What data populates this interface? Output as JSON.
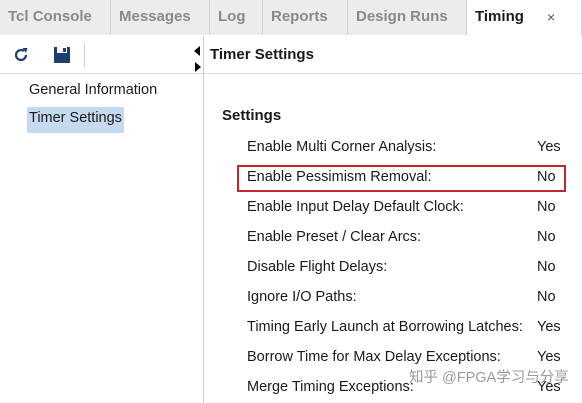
{
  "tabs": [
    {
      "label": "Tcl Console"
    },
    {
      "label": "Messages"
    },
    {
      "label": "Log"
    },
    {
      "label": "Reports"
    },
    {
      "label": "Design Runs"
    },
    {
      "label": "Timing"
    }
  ],
  "tab_close_glyph": "×",
  "toolbar": {
    "refresh_icon": "refresh-icon",
    "save_icon": "save-icon"
  },
  "nav": {
    "items": [
      {
        "label": "General Information"
      },
      {
        "label": "Timer Settings"
      }
    ],
    "selected": "Timer Settings"
  },
  "panel": {
    "title": "Timer Settings",
    "section": "Settings",
    "settings": [
      {
        "label": "Enable Multi Corner Analysis:",
        "value": "Yes"
      },
      {
        "label": "Enable Pessimism Removal:",
        "value": "No"
      },
      {
        "label": "Enable Input Delay Default Clock:",
        "value": "No"
      },
      {
        "label": "Enable Preset / Clear Arcs:",
        "value": "No"
      },
      {
        "label": "Disable Flight Delays:",
        "value": "No"
      },
      {
        "label": "Ignore I/O Paths:",
        "value": "No"
      },
      {
        "label": "Timing Early Launch at Borrowing Latches:",
        "value": "Yes"
      },
      {
        "label": "Borrow Time for Max Delay Exceptions:",
        "value": "Yes"
      },
      {
        "label": "Merge Timing Exceptions:",
        "value": "Yes"
      }
    ]
  },
  "watermark": "知乎 @FPGA学习与分享",
  "colors": {
    "highlight": "#c0272d",
    "selection": "#c5d9f1",
    "save_icon": "#1f3f73"
  }
}
